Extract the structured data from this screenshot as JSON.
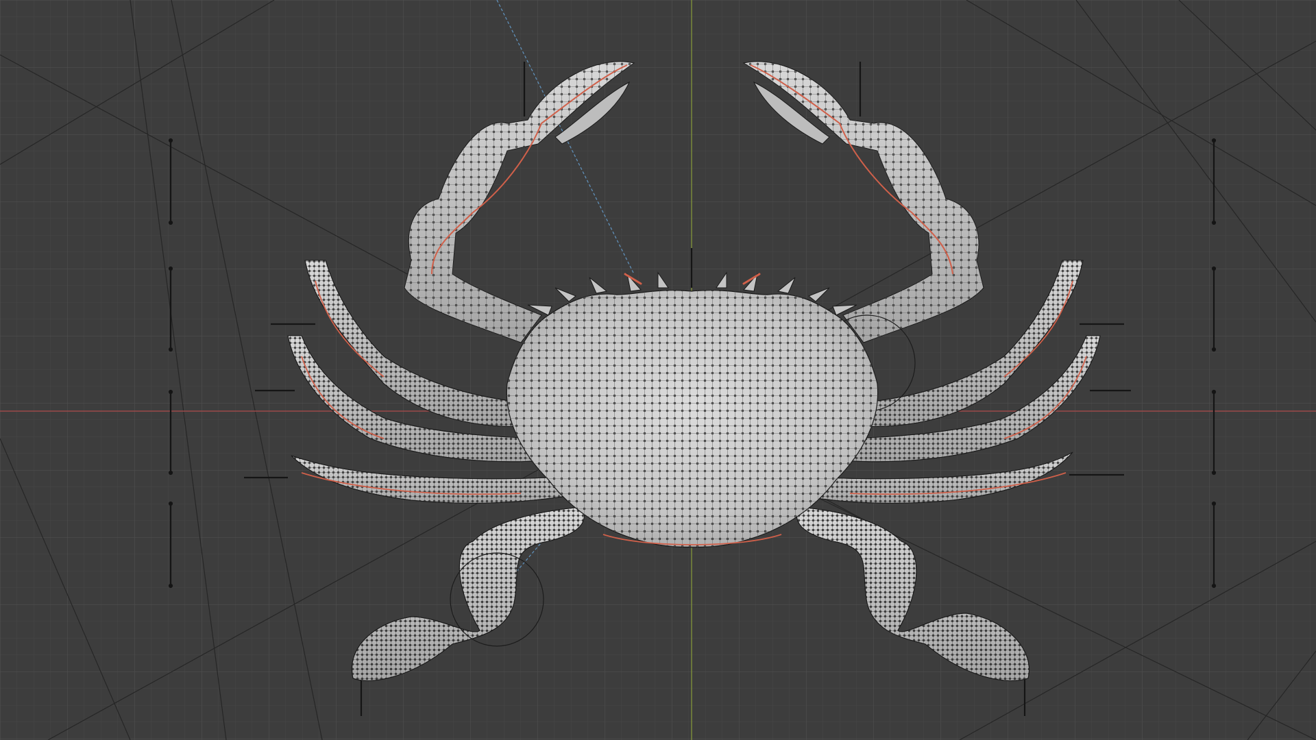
{
  "app": {
    "view": "3d-viewport",
    "mode": "edit-mode-wireframe-overlay",
    "subject": "crab-mesh"
  },
  "colors": {
    "background": "#3d3d3d",
    "grid_minor": "#474747",
    "grid_major": "#515151",
    "axis_x": "#9b4a4a",
    "axis_y": "#7d8f3b",
    "mesh_fill": "#cfcfcf",
    "mesh_shade": "#a9a9a9",
    "vertex": "#111111",
    "seam": "#d0604a",
    "rig_line": "#1b1b1b",
    "guide_dashed": "#5f8fb8"
  },
  "icons": {
    "legs": "crab-leg-icon",
    "claws": "crab-claw-icon"
  }
}
